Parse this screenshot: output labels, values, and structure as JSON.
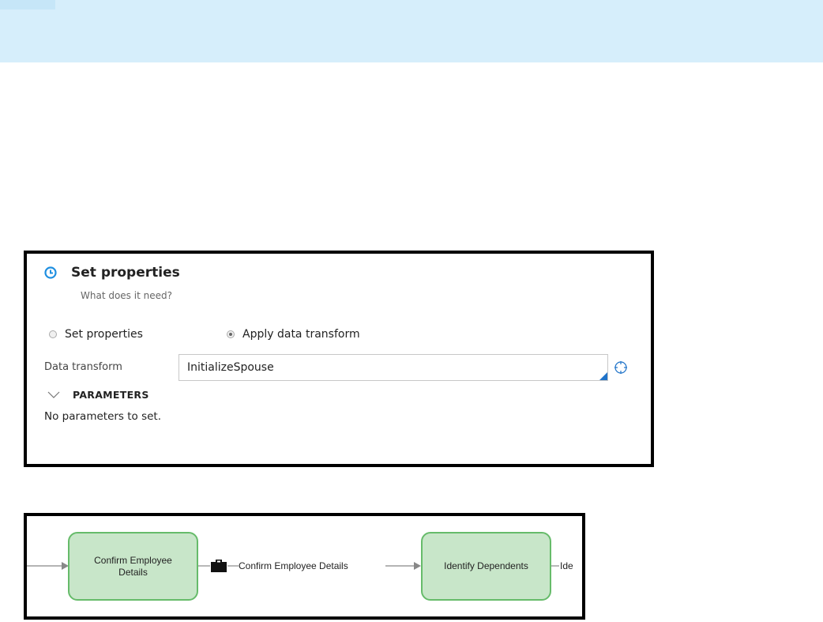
{
  "props": {
    "title": "Set properties",
    "subtitle": "What does it need?",
    "option_set_properties": "Set properties",
    "option_apply_transform": "Apply data transform",
    "selected_option": "Apply data transform",
    "data_transform_label": "Data transform",
    "data_transform_value": "InitializeSpouse",
    "parameters_label": "PARAMETERS",
    "no_parameters_text": "No parameters to set."
  },
  "flow": {
    "step1_label": "Confirm Employee Details",
    "connector1_label": "Confirm Employee Details",
    "step2_label": "Identify Dependents",
    "connector2_label": "Ide"
  },
  "icons": {
    "header_icon": "clock-icon",
    "picker_icon": "crosshair-icon",
    "collapse_icon": "chevron-down-icon",
    "assignment_icon": "clipboard-icon"
  },
  "colors": {
    "accent": "#1f73c9",
    "step_fill": "#c8e6c9",
    "step_border": "#66bb6a",
    "banner": "#d6eefb"
  }
}
